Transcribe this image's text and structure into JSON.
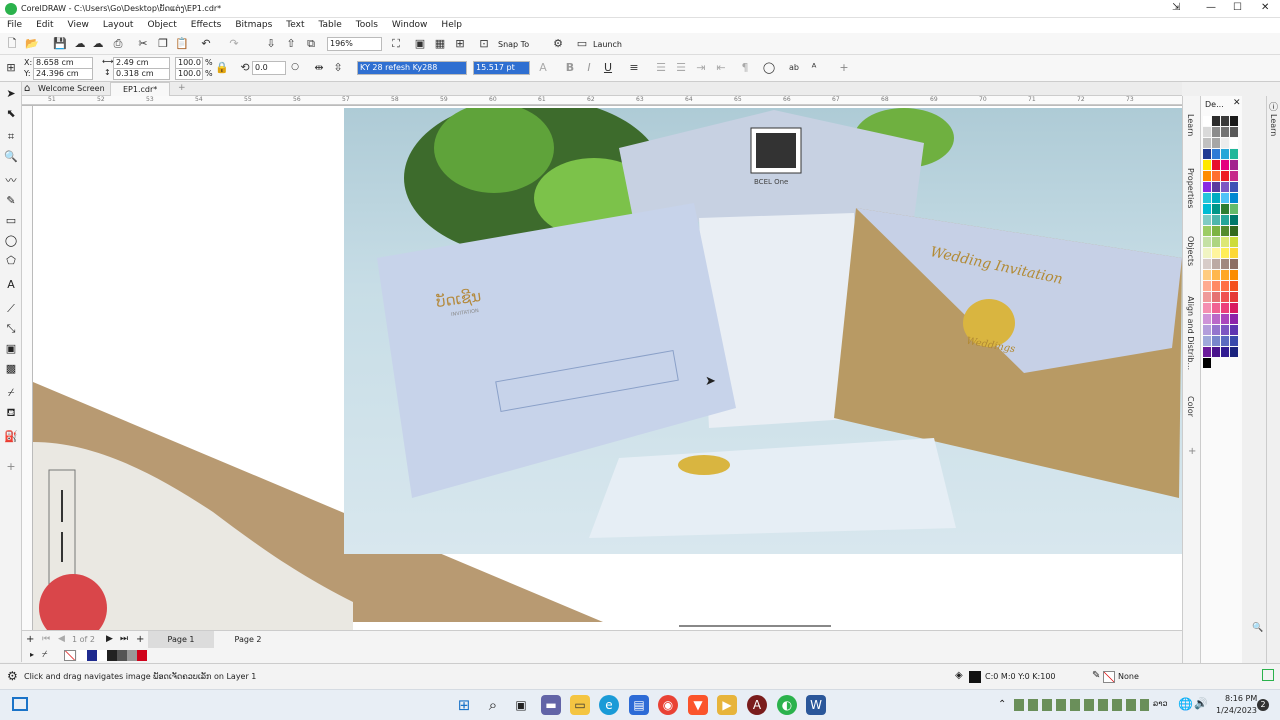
{
  "window": {
    "title": "CorelDRAW - C:\\Users\\Go\\Desktop\\ບັດແຕ່ງ\\EP1.cdr*",
    "controls": {
      "minimize": "—",
      "maximize": "☐",
      "close": "✕"
    }
  },
  "menu": [
    "File",
    "Edit",
    "View",
    "Layout",
    "Object",
    "Effects",
    "Bitmaps",
    "Text",
    "Table",
    "Tools",
    "Window",
    "Help"
  ],
  "toolbar": {
    "zoom": "196%",
    "snap_label": "Snap To",
    "launch_label": "Launch"
  },
  "propbar": {
    "x": "8.658 cm",
    "y": "24.396 cm",
    "w": "2.49 cm",
    "h": "0.318 cm",
    "scale_w": "100.0",
    "scale_h": "100.0",
    "pct": "%",
    "angle": "0.0",
    "font": "KY 28 refesh Ky288",
    "size": "15.517 pt"
  },
  "tabs": [
    "Welcome Screen",
    "EP1.cdr*"
  ],
  "ruler_ticks": [
    "51",
    "52",
    "53",
    "54",
    "55",
    "56",
    "57",
    "58",
    "59",
    "60",
    "61",
    "62",
    "63",
    "64",
    "65",
    "66",
    "67",
    "68",
    "69",
    "70",
    "71",
    "72",
    "73"
  ],
  "pages": {
    "counter": "1 of 2",
    "page1": "Page 1",
    "page2": "Page 2"
  },
  "dock_tabs": [
    "Learn",
    "Properties",
    "Objects",
    "Align and Distrib...",
    "Color"
  ],
  "palette": {
    "header": "De...",
    "colors": [
      "#ffffff",
      "#2b2b2b",
      "#3a3a3a",
      "#1a1a1a",
      "#d9d9d9",
      "#8c8c8c",
      "#737373",
      "#595959",
      "#c0c0c0",
      "#a6a6a6",
      "#ececec",
      "#ffffff",
      "#1f3a93",
      "#2e7bd6",
      "#27a7d8",
      "#1fb79a",
      "#ffe800",
      "#e8112d",
      "#e4007f",
      "#a3238e",
      "#ff8c00",
      "#ff6f2e",
      "#ed1c24",
      "#c62a8a",
      "#8a2be2",
      "#5b3a9e",
      "#7e57c2",
      "#3f51b5",
      "#26c6da",
      "#00acc1",
      "#4fc3f7",
      "#0288d1",
      "#00bcd4",
      "#009688",
      "#2e7d32",
      "#66bb6a",
      "#80cbc4",
      "#4db6ac",
      "#26a69a",
      "#00796b",
      "#9ccc65",
      "#7cb342",
      "#558b2f",
      "#33691e",
      "#c5e1a5",
      "#aed581",
      "#dce775",
      "#cddc39",
      "#f0f4c3",
      "#fff59d",
      "#ffee58",
      "#fdd835",
      "#d7ccc8",
      "#bcaaa4",
      "#a1887f",
      "#8d6e63",
      "#ffcc80",
      "#ffb74d",
      "#ffa726",
      "#fb8c00",
      "#ffab91",
      "#ff8a65",
      "#ff7043",
      "#f4511e",
      "#ef9a9a",
      "#e57373",
      "#ef5350",
      "#e53935",
      "#f48fb1",
      "#f06292",
      "#ec407a",
      "#d81b60",
      "#ce93d8",
      "#ba68c8",
      "#ab47bc",
      "#8e24aa",
      "#b39ddb",
      "#9575cd",
      "#7e57c2",
      "#5e35b1",
      "#9fa8da",
      "#7986cb",
      "#5c6bc0",
      "#3949ab",
      "#6a1b9a",
      "#4a148c",
      "#311b92",
      "#1a237e",
      "#000000"
    ]
  },
  "bottom_palette": [
    "#ffffff",
    "#1f2b8f",
    "#ffffff",
    "#222222",
    "#555555",
    "#999999",
    "#d0021b"
  ],
  "status": {
    "hint": "Click and drag navigates image",
    "layer": "ພັອດເຈັດຄວບເລັກ on Layer 1",
    "fill": "C:0 M:0 Y:0 K:100",
    "outline": "None"
  },
  "clock": {
    "time": "8:16 PM",
    "date": "1/24/2023",
    "lang": "ລາວ"
  },
  "image_text": {
    "invite_small": "ບັດເຊີນ",
    "invitation": "INVITATION",
    "wedding": "Wedding Invitation",
    "weddings": "Weddings",
    "qr_label": "BCEL One"
  }
}
